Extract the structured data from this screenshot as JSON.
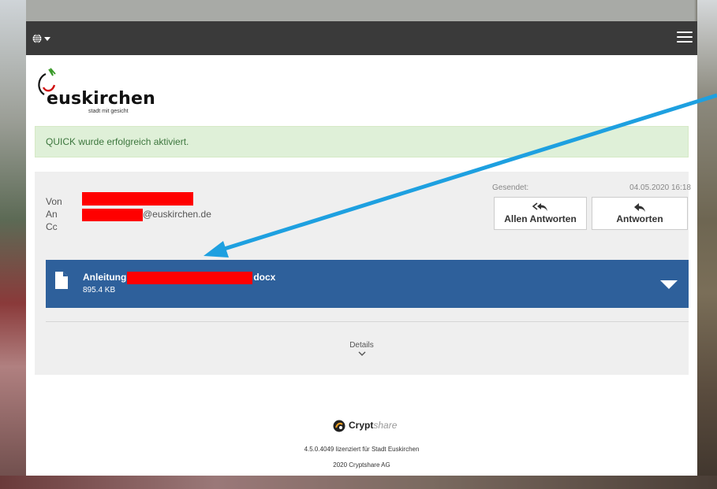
{
  "header": {
    "language_icon": "globe-icon",
    "menu_icon": "hamburger-menu-icon"
  },
  "logo": {
    "name": "euskirchen",
    "tagline": "stadt mit gesicht"
  },
  "alert": {
    "message": "QUICK wurde erfolgreich aktiviert.",
    "color": "#3c763d",
    "background": "#dff0d8"
  },
  "message": {
    "from_label": "Von",
    "to_label": "An",
    "to_domain": "@euskirchen.de",
    "cc_label": "Cc",
    "sent_label": "Gesendet:",
    "sent_date": "04.05.2020 16:18",
    "reply_all_label": "Allen Antworten",
    "reply_label": "Antworten",
    "redaction_color": "#ff0000"
  },
  "attachment": {
    "name_prefix": "Anleitung",
    "name_suffix": "docx",
    "size": "895.4 KB",
    "icon": "file-icon",
    "color": "#2e609b"
  },
  "details": {
    "label": "Details"
  },
  "footer": {
    "brand_bold": "Crypt",
    "brand_italic": "share",
    "license": "4.5.0.4049 lizenziert für Stadt Euskirchen",
    "copyright": "2020 Cryptshare AG"
  },
  "annotation": {
    "arrow_color": "#1ea0e0"
  }
}
